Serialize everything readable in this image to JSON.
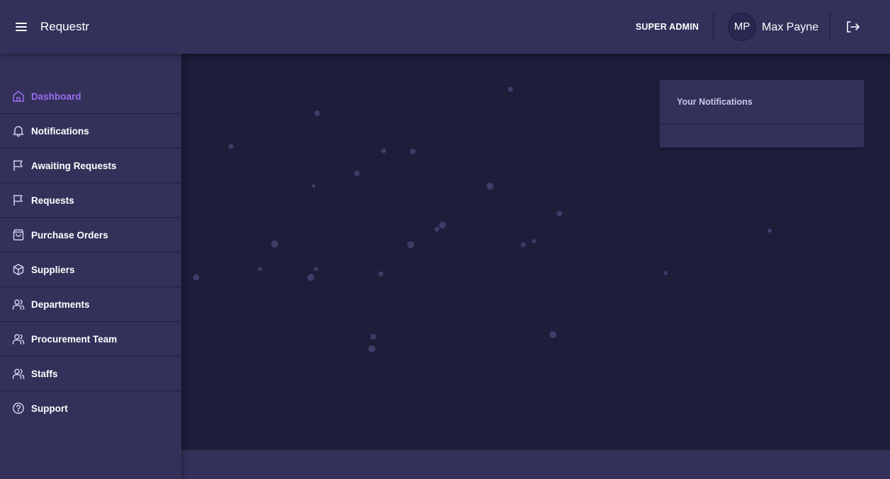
{
  "app": {
    "title": "Requestr"
  },
  "header": {
    "role": "SUPER ADMIN",
    "user": {
      "initials": "MP",
      "name": "Max Payne"
    }
  },
  "sidebar": {
    "items": [
      {
        "label": "Dashboard",
        "icon": "home-icon",
        "active": true
      },
      {
        "label": "Notifications",
        "icon": "bell-icon"
      },
      {
        "label": "Awaiting Requests",
        "icon": "flag-icon"
      },
      {
        "label": "Requests",
        "icon": "flag-icon"
      },
      {
        "label": "Purchase Orders",
        "icon": "shopping-bag-icon"
      },
      {
        "label": "Suppliers",
        "icon": "box-icon"
      },
      {
        "label": "Departments",
        "icon": "users-icon"
      },
      {
        "label": "Procurement Team",
        "icon": "users-icon"
      },
      {
        "label": "Staffs",
        "icon": "users-icon"
      },
      {
        "label": "Support",
        "icon": "help-circle-icon"
      }
    ]
  },
  "notifications": {
    "title": "Your Notifications"
  },
  "colors": {
    "background": "#1e1d3a",
    "surface": "#33315a",
    "accent": "#9b6cf0",
    "text": "#ffffff"
  }
}
